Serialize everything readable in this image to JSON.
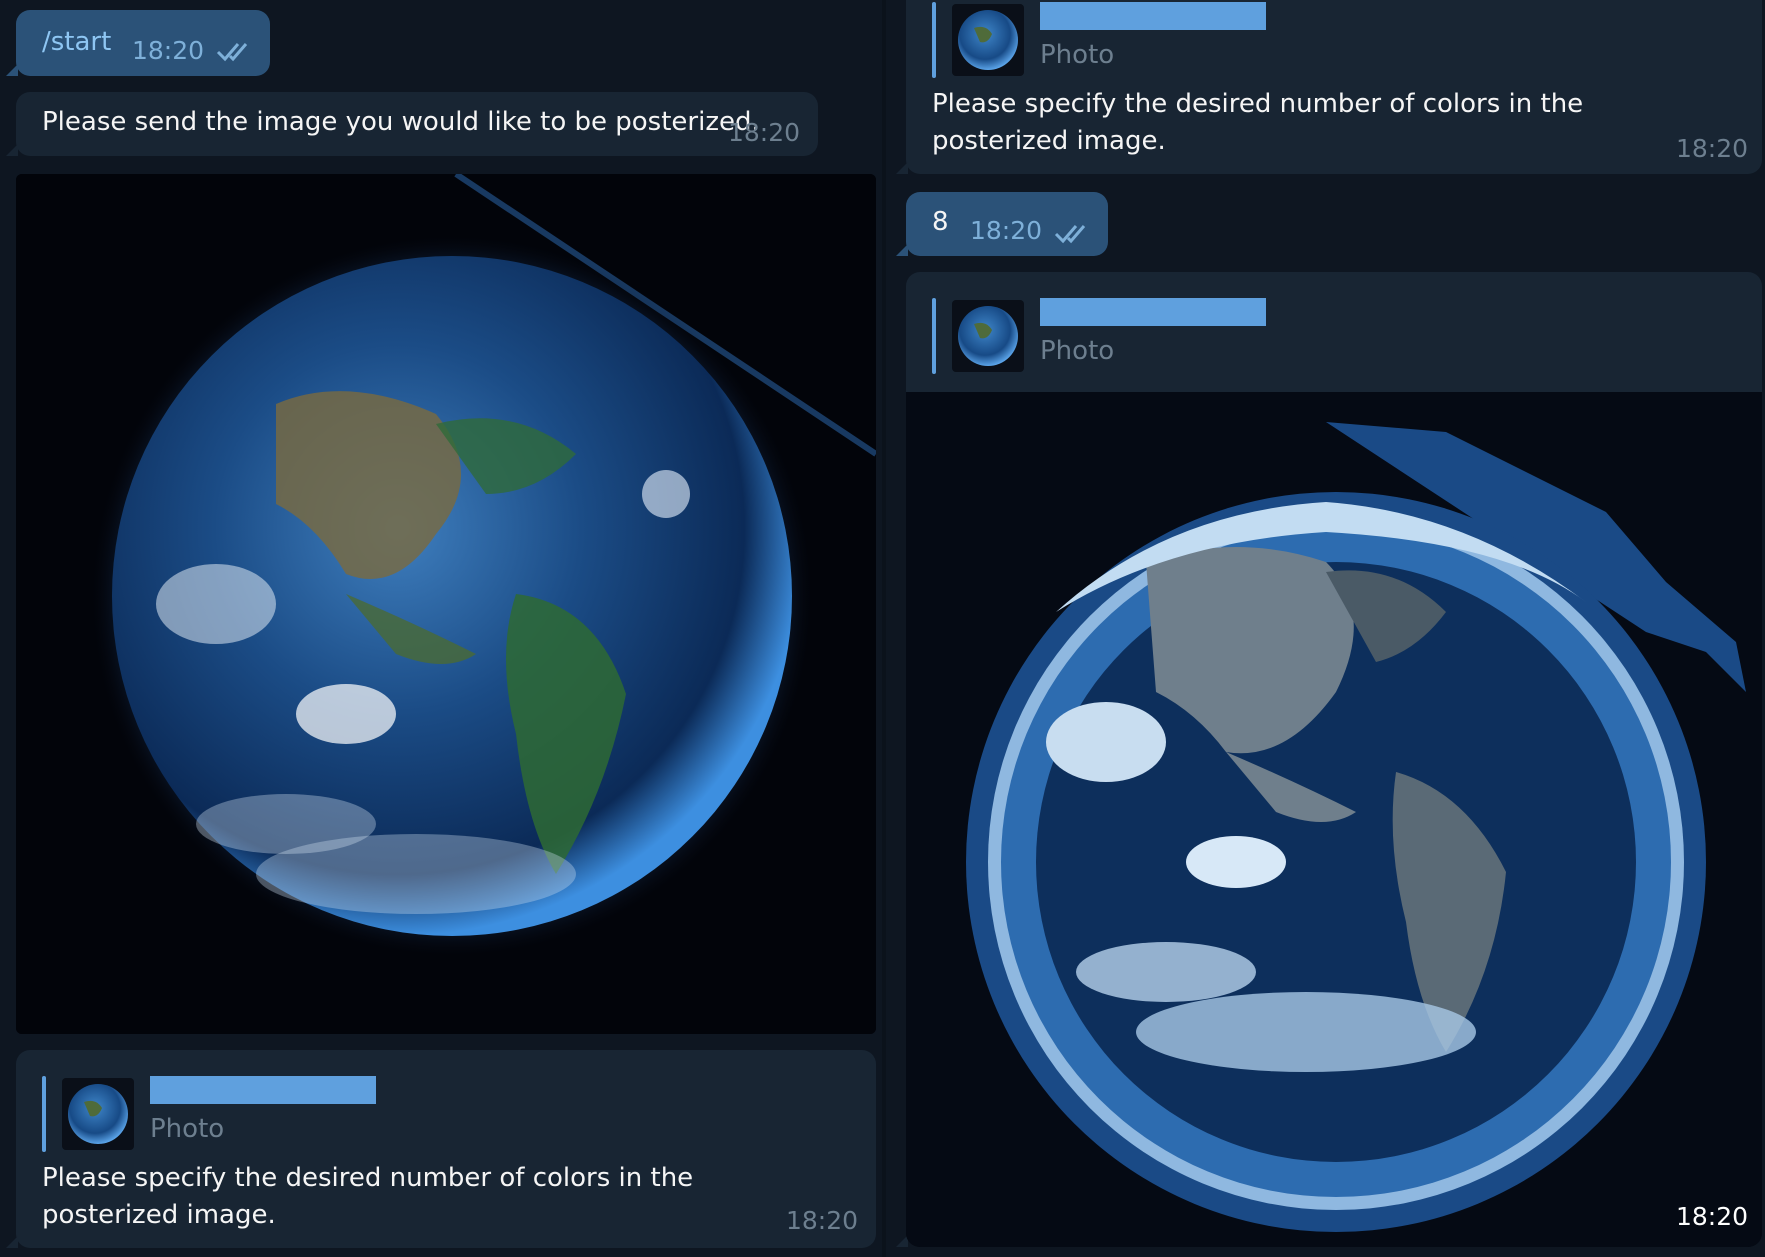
{
  "messages": {
    "start_cmd": {
      "text": "/start",
      "time": "18:20"
    },
    "bot_prompt_image": {
      "text": "Please send the image you would like to be posterized.",
      "time": "18:20"
    },
    "bot_prompt_colors_left": {
      "reply_label": "Photo",
      "text": "Please specify the desired number of colors in the posterized image.",
      "time": "18:20"
    },
    "bot_prompt_colors_right": {
      "reply_label": "Photo",
      "text": "Please specify the desired number of colors in the posterized image.",
      "time": "18:20"
    },
    "user_number": {
      "text": "8",
      "time": "18:20"
    },
    "bot_result": {
      "reply_label": "Photo",
      "time": "18:20"
    }
  },
  "colors": {
    "background": "#0e1621",
    "incoming_bubble": "#182533",
    "outgoing_bubble": "#2b5278",
    "accent": "#5fa0de",
    "muted_text": "#6d7f8f"
  },
  "icons": {
    "read_receipt": "double-check-icon"
  }
}
